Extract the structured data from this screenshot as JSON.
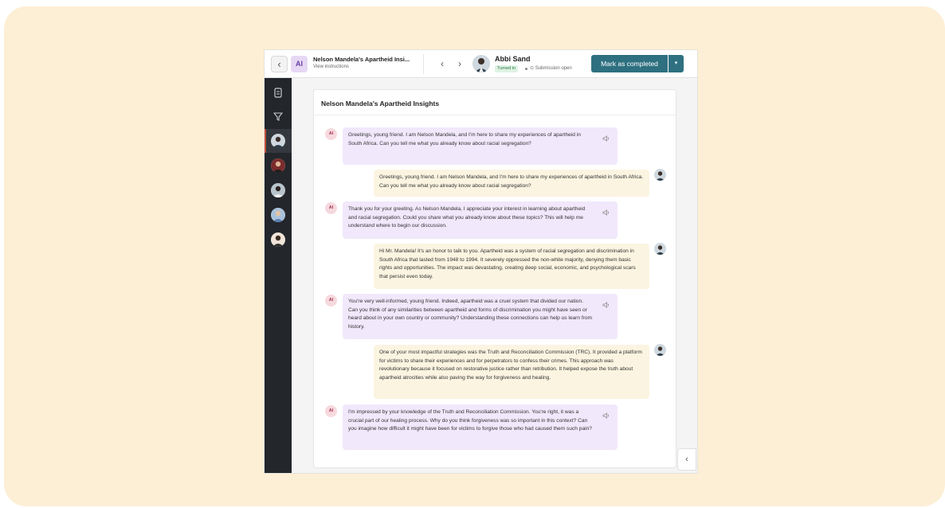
{
  "header": {
    "back_label": "‹",
    "ai_tile": "AI",
    "assignment_title": "Nelson Mandela's Apartheid Insi...",
    "view_instructions": "View instructions",
    "prev_label": "‹",
    "next_label": "›",
    "student_name": "Abbi Sand",
    "status": "Turned in",
    "submission_status": "Submission open",
    "mark_button": "Mark as completed",
    "mark_caret": "▾"
  },
  "sidebar": {
    "icons": [
      "document-icon",
      "filter-icon"
    ],
    "student_count": 5
  },
  "chat": {
    "title": "Nelson Mandela's Apartheid Insights",
    "ai_badge": "AI",
    "messages": [
      {
        "role": "ai",
        "text": "Greetings, young friend. I am Nelson Mandela, and I'm here to share my experiences of apartheid in South Africa. Can you tell me what you already know about racial segregation?"
      },
      {
        "role": "user",
        "text": "Greetings, young friend. I am Nelson Mandela, and I'm here to share my experiences of apartheid in South Africa. Can you tell me what you already know about racial segregation?"
      },
      {
        "role": "ai",
        "text": "Thank you for your greeting. As Nelson Mandela, I appreciate your interest in learning about apartheid and racial segregation. Could you share what you already know about these topics? This will help me understand where to begin our discussion."
      },
      {
        "role": "user",
        "text": "Hi Mr. Mandela! It's an honor to talk to you. Apartheid was a system of racial segregation and discrimination in South Africa that lasted from 1948 to 1994. It severely oppressed the non-white majority, denying them basic rights and opportunities. The impact was devastating, creating deep social, economic, and psychological scars that persist even today."
      },
      {
        "role": "ai",
        "text": "You're very well-informed, young friend. Indeed, apartheid was a cruel system that divided our nation. Can you think of any similarities between apartheid and forms of discrimination you might have seen or heard about in your own country or community? Understanding these connections can help us learn from history."
      },
      {
        "role": "user",
        "text": "One of your most impactful strategies was the Truth and Reconciliation Commission (TRC). It provided a platform for victims to share their experiences and for perpetrators to confess their crimes. This approach was revolutionary because it focused on restorative justice rather than retribution. It helped expose the truth about apartheid atrocities while also paving the way for forgiveness and healing."
      },
      {
        "role": "ai",
        "text": "I'm impressed by your knowledge of the Truth and Reconciliation Commission. You're right, it was a crucial part of our healing process. Why do you think forgiveness was so important in this context? Can you imagine how difficult it might have been for victims to forgive those who had caused them such pain?"
      }
    ]
  },
  "collapse_label": "‹",
  "colors": {
    "page_bg": "#fdefd6",
    "accent": "#2e7080",
    "ai_bubble": "#f1e8fb",
    "user_bubble": "#fbf4e1",
    "sidebar": "#23262b"
  }
}
